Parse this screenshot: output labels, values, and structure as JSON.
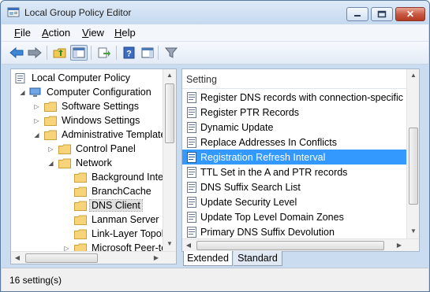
{
  "window": {
    "title": "Local Group Policy Editor"
  },
  "menu": [
    {
      "label": "File",
      "accel": "F",
      "rest": "ile"
    },
    {
      "label": "Action",
      "accel": "A",
      "rest": "ction"
    },
    {
      "label": "View",
      "accel": "V",
      "rest": "iew"
    },
    {
      "label": "Help",
      "accel": "H",
      "rest": "elp"
    }
  ],
  "tree": {
    "items": [
      {
        "label": "Local Computer Policy"
      },
      {
        "label": "Computer Configuration"
      },
      {
        "label": "Software Settings"
      },
      {
        "label": "Windows Settings"
      },
      {
        "label": "Administrative Templates"
      },
      {
        "label": "Control Panel"
      },
      {
        "label": "Network"
      },
      {
        "label": "Background Intelligent Transfer Service (BITS)"
      },
      {
        "label": "BranchCache"
      },
      {
        "label": "DNS Client",
        "selected": true
      },
      {
        "label": "Lanman Server"
      },
      {
        "label": "Link-Layer Topology Discovery"
      },
      {
        "label": "Microsoft Peer-to-Peer Networking Services"
      }
    ]
  },
  "list": {
    "column_header": "Setting",
    "rows": [
      {
        "label": "Register DNS records with connection-specific DNS suffix"
      },
      {
        "label": "Register PTR Records"
      },
      {
        "label": "Dynamic Update"
      },
      {
        "label": "Replace Addresses In Conflicts"
      },
      {
        "label": "Registration Refresh Interval",
        "selected": true
      },
      {
        "label": "TTL Set in the A and PTR records"
      },
      {
        "label": "DNS Suffix Search List"
      },
      {
        "label": "Update Security Level"
      },
      {
        "label": "Update Top Level Domain Zones"
      },
      {
        "label": "Primary DNS Suffix Devolution"
      }
    ]
  },
  "tabs": {
    "extended": "Extended",
    "standard": "Standard"
  },
  "status": {
    "text": "16 setting(s)"
  },
  "colors": {
    "selection": "#3399ff",
    "window_frame": "#c9dcf0"
  },
  "toolbar_icons": [
    "back-arrow-icon",
    "forward-arrow-icon",
    "up-folder-icon",
    "show-hide-tree-icon",
    "export-list-icon",
    "help-icon",
    "properties-pane-icon",
    "filter-icon"
  ]
}
